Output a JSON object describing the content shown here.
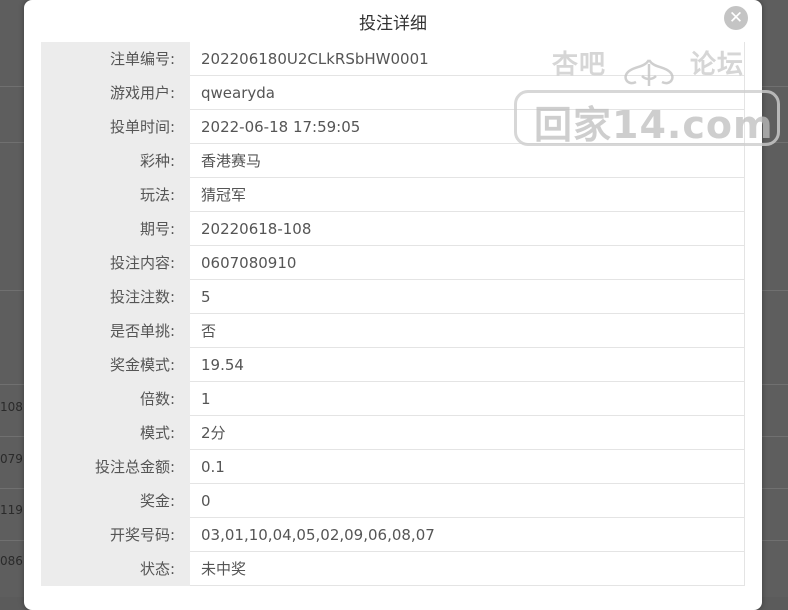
{
  "modal": {
    "title": "投注详细",
    "close_symbol": "✕"
  },
  "details": [
    {
      "label": "注单编号:",
      "value": "202206180U2CLkRSbHW0001"
    },
    {
      "label": "游戏用户:",
      "value": "qwearyda"
    },
    {
      "label": "投单时间:",
      "value": "2022-06-18 17:59:05"
    },
    {
      "label": "彩种:",
      "value": "香港赛马"
    },
    {
      "label": "玩法:",
      "value": "猜冠军"
    },
    {
      "label": "期号:",
      "value": "20220618-108"
    },
    {
      "label": "投注内容:",
      "value": "0607080910"
    },
    {
      "label": "投注注数:",
      "value": "5"
    },
    {
      "label": "是否单挑:",
      "value": "否"
    },
    {
      "label": "奖金模式:",
      "value": "19.54"
    },
    {
      "label": "倍数:",
      "value": "1"
    },
    {
      "label": "模式:",
      "value": "2分"
    },
    {
      "label": "投注总金额:",
      "value": "0.1"
    },
    {
      "label": "奖金:",
      "value": "0"
    },
    {
      "label": "开奖号码:",
      "value": "03,01,10,04,05,02,09,06,08,07"
    },
    {
      "label": "状态:",
      "value": "未中奖"
    }
  ],
  "watermark": {
    "top_left": "杏吧",
    "top_right": "论坛",
    "main": "回家14.com"
  },
  "background": {
    "fragments": [
      "108",
      "079",
      "119",
      "086"
    ]
  }
}
